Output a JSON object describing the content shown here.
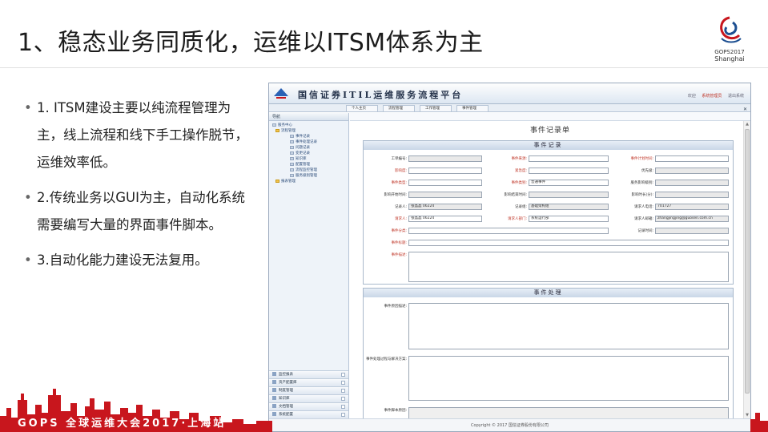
{
  "slide": {
    "title": "1、稳态业务同质化，运维以ITSM体系为主",
    "logo_line1": "GOPS2017",
    "logo_line2": "Shanghai",
    "bullets": [
      "1. ITSM建设主要以纯流程管理为主，线上流程和线下手工操作脱节，运维效率低。",
      "2.传统业务以GUI为主，自动化系统需要编写大量的界面事件脚本。",
      "3.自动化能力建设无法复用。"
    ],
    "banner": "GOPS 全球运维大会2017·上海站"
  },
  "colors": {
    "banner_red": "#c8161d",
    "app_border": "#9aa9bd",
    "required_label": "#c0392b"
  },
  "app": {
    "title": "国信证券ITIL运维服务流程平台",
    "top_right": [
      "欢迎",
      "系统管理员",
      "退出系统"
    ],
    "tabs": [
      "个人主页",
      "流程管理",
      "工作管理",
      "事件管理"
    ],
    "sidebar": {
      "header": "导航",
      "tree": [
        {
          "label": "服务中心",
          "level": 0
        },
        {
          "label": "流程管理",
          "level": 1
        },
        {
          "label": "事件记录",
          "level": 2
        },
        {
          "label": "事件处理记录",
          "level": 2
        },
        {
          "label": "问题记录",
          "level": 2
        },
        {
          "label": "变更记录",
          "level": 2
        },
        {
          "label": "知识库",
          "level": 2
        },
        {
          "label": "配置管理",
          "level": 2
        },
        {
          "label": "流程监控管理",
          "level": 2
        },
        {
          "label": "服务级别管理",
          "level": 2
        },
        {
          "label": "报表管理",
          "level": 1
        }
      ],
      "bottom": [
        "监控报表",
        "资产配置库",
        "制度管理",
        "知识库",
        "文档管理",
        "系统配置"
      ]
    },
    "form": {
      "title": "事件记录单",
      "section1": "事件记录",
      "section2": "事件处理",
      "fields": {
        "event_no": "工单编号:",
        "event_source": "事件来源:",
        "event_plan_time": "事件计划时间:",
        "impact": "影响度:",
        "urgency": "紧急度:",
        "priority": "优先级:",
        "category": "事件类型:",
        "event_type": "事件类别:",
        "event_type_val": "普通事件",
        "service": "服务影响级别:",
        "impact_start": "影响开始时间:",
        "impact_end": "影响结束时间:",
        "impact_dur": "影响时长(分):",
        "recorder": "记录人:",
        "recorder_val": "张晶晶 06224",
        "group": "记录组:",
        "group_val": "基础架构组",
        "req_time": "请求人电话:",
        "req_time_val": "701727",
        "requester": "请求人:",
        "requester_val": "张晶晶 06224",
        "req_dept": "请求人部门:",
        "req_dept_val": "系统运行部",
        "req_mail": "请求人邮箱:",
        "req_mail_val": "zhangjingjing@guosen.com.cn",
        "classify": "事件分类:",
        "record_time": "记录时间:",
        "event_title": "事件标题:",
        "event_desc": "事件描述:",
        "root_cause": "事件原因描述:",
        "solution": "事件处理过程与解决方案:",
        "script": "事件脚本原因:"
      }
    },
    "footer": "Copyright © 2017 国信证券股份有限公司"
  }
}
